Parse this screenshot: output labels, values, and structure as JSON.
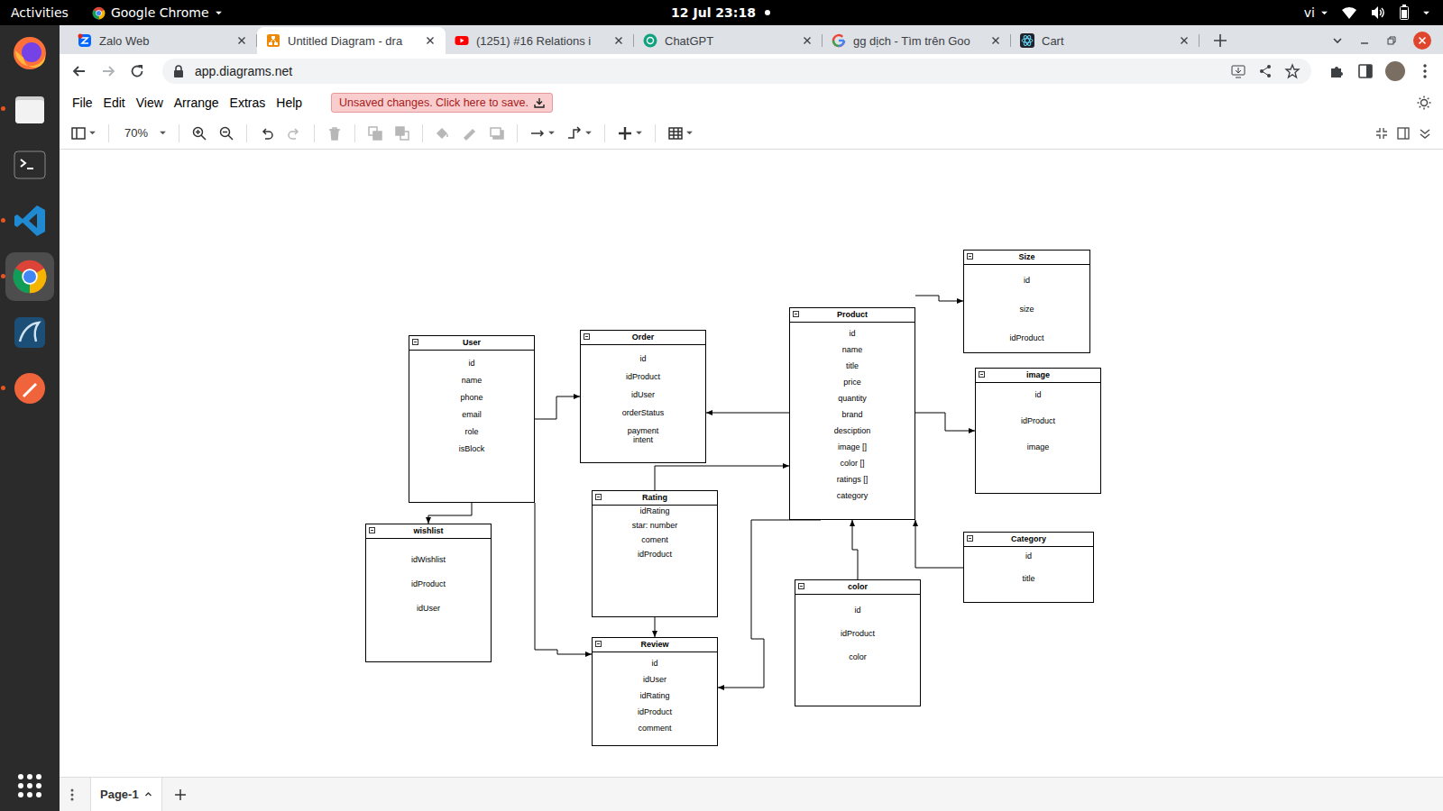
{
  "topbar": {
    "activities": "Activities",
    "app": "Google Chrome",
    "clock": "12 Jul 23:18",
    "notification": true,
    "input_source": "vi"
  },
  "dock": [
    {
      "running": false,
      "selected": false
    },
    {
      "running": true,
      "selected": false
    },
    {
      "running": false,
      "selected": false
    },
    {
      "running": true,
      "selected": false
    },
    {
      "running": true,
      "selected": true
    },
    {
      "running": false,
      "selected": false
    },
    {
      "running": true,
      "selected": false
    }
  ],
  "browser": {
    "tabs": [
      {
        "label": "Zalo Web",
        "selected": false
      },
      {
        "label": "Untitled Diagram - dra",
        "selected": true
      },
      {
        "label": "(1251) #16 Relations i",
        "selected": false
      },
      {
        "label": "ChatGPT",
        "selected": false
      },
      {
        "label": "gg dịch - Tìm trên Goo",
        "selected": false
      },
      {
        "label": "Cart",
        "selected": false
      }
    ],
    "url": "app.diagrams.net"
  },
  "drawio": {
    "menu": [
      "File",
      "Edit",
      "View",
      "Arrange",
      "Extras",
      "Help"
    ],
    "unsaved": "Unsaved changes. Click here to save.",
    "toolbar": [
      [
        {
          "kind": "panel",
          "disabled": false
        }
      ],
      [
        {
          "kind": "zoom",
          "label": "70%",
          "disabled": false
        }
      ],
      [
        {
          "kind": "zoom-in",
          "disabled": false
        },
        {
          "kind": "zoom-out",
          "disabled": false
        }
      ],
      [
        {
          "kind": "undo",
          "disabled": false
        },
        {
          "kind": "redo",
          "disabled": true
        }
      ],
      [
        {
          "kind": "delete",
          "disabled": true
        }
      ],
      [
        {
          "kind": "to-front",
          "disabled": true
        },
        {
          "kind": "to-back",
          "disabled": true
        }
      ],
      [
        {
          "kind": "fill",
          "disabled": true
        },
        {
          "kind": "line-color",
          "disabled": true
        },
        {
          "kind": "shadow",
          "disabled": true
        }
      ],
      [
        {
          "kind": "connection",
          "disabled": false
        },
        {
          "kind": "waypoints",
          "disabled": false
        }
      ],
      [
        {
          "kind": "insert",
          "disabled": false
        }
      ],
      [
        {
          "kind": "table",
          "disabled": false
        }
      ]
    ],
    "pages": [
      {
        "label": "Page-1",
        "selected": true
      }
    ]
  },
  "diagram": {
    "entities": [
      {
        "title": "User",
        "fields": [
          "id",
          "name",
          "phone",
          "email",
          "role",
          "isBlock"
        ]
      },
      {
        "title": "Order",
        "fields": [
          "id",
          "idProduct",
          "idUser",
          "orderStatus",
          "payment intent"
        ]
      },
      {
        "title": "Product",
        "fields": [
          "id",
          "name",
          "title",
          "price",
          "quantity",
          "brand",
          "desciption",
          "image []",
          "color []",
          "ratings []",
          "category"
        ]
      },
      {
        "title": "Size",
        "fields": [
          "id",
          "size",
          "idProduct"
        ]
      },
      {
        "title": "image",
        "fields": [
          "id",
          "idProduct",
          "image"
        ]
      },
      {
        "title": "Category",
        "fields": [
          "id",
          "title"
        ]
      },
      {
        "title": "wishlist",
        "fields": [
          "idWishlist",
          "idProduct",
          "idUser"
        ]
      },
      {
        "title": "Rating",
        "fields": [
          "idRating",
          "star: number",
          "coment",
          "idProduct"
        ]
      },
      {
        "title": "Review",
        "fields": [
          "id",
          "idUser",
          "idRating",
          "idProduct",
          "comment"
        ]
      },
      {
        "title": "color",
        "fields": [
          "id",
          "idProduct",
          "color"
        ]
      }
    ]
  }
}
